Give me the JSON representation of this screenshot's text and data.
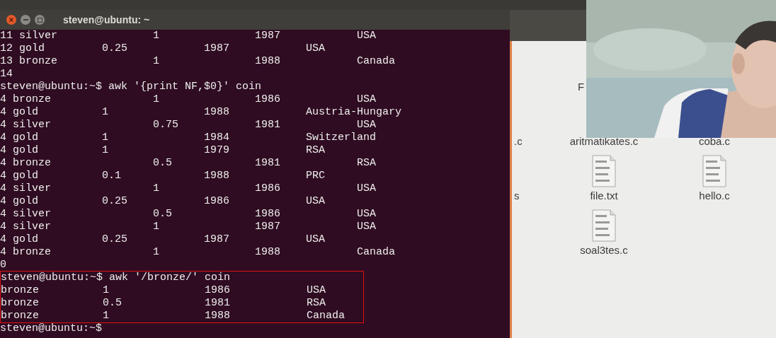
{
  "terminal": {
    "title": "steven@ubuntu: ~",
    "lines": [
      {
        "text": "11 silver\t\t1\t\t1987\t\tUSA",
        "highlighted": false
      },
      {
        "text": "12 gold\t\t0.25\t\t1987\t\tUSA",
        "highlighted": false
      },
      {
        "text": "13 bronze\t\t1\t\t1988\t\tCanada",
        "highlighted": false
      },
      {
        "text": "14",
        "highlighted": false
      },
      {
        "text": "steven@ubuntu:~$ awk '{print NF,$0}' coin",
        "highlighted": false
      },
      {
        "text": "4 bronze\t\t1\t\t1986\t\tUSA",
        "highlighted": false
      },
      {
        "text": "4 gold\t\t1\t\t1988\t\tAustria-Hungary",
        "highlighted": false
      },
      {
        "text": "4 silver\t\t0.75\t\t1981\t\tUSA",
        "highlighted": false
      },
      {
        "text": "4 gold\t\t1\t\t1984\t\tSwitzerland",
        "highlighted": false
      },
      {
        "text": "4 gold\t\t1\t\t1979\t\tRSA",
        "highlighted": false
      },
      {
        "text": "4 bronze\t\t0.5\t\t1981\t\tRSA",
        "highlighted": false
      },
      {
        "text": "4 gold\t\t0.1\t\t1988\t\tPRC",
        "highlighted": false
      },
      {
        "text": "4 silver\t\t1\t\t1986\t\tUSA",
        "highlighted": false
      },
      {
        "text": "4 gold\t\t0.25\t\t1986\t\tUSA",
        "highlighted": false
      },
      {
        "text": "4 silver\t\t0.5\t\t1986\t\tUSA",
        "highlighted": false
      },
      {
        "text": "4 silver\t\t1\t\t1987\t\tUSA",
        "highlighted": false
      },
      {
        "text": "4 gold\t\t0.25\t\t1987\t\tUSA",
        "highlighted": false
      },
      {
        "text": "4 bronze\t\t1\t\t1988\t\tCanada",
        "highlighted": false
      },
      {
        "text": "0",
        "highlighted": false
      },
      {
        "text": "steven@ubuntu:~$ awk '/bronze/' coin",
        "highlighted": true
      },
      {
        "text": "bronze\t\t1\t\t1986\t\tUSA",
        "highlighted": true
      },
      {
        "text": "bronze\t\t0.5\t\t1981\t\tRSA",
        "highlighted": true
      },
      {
        "text": "bronze\t\t1\t\t1988\t\tCanada",
        "highlighted": true
      },
      {
        "text": "steven@ubuntu:~$",
        "highlighted": false
      }
    ]
  },
  "file_manager": {
    "rows": [
      [
        {
          "kind": "empty"
        },
        {
          "kind": "name",
          "label": "F"
        },
        {
          "kind": "empty"
        }
      ],
      [
        {
          "kind": "name",
          "label": ".c"
        },
        {
          "kind": "name",
          "label": "aritmatikates.c"
        },
        {
          "kind": "name",
          "label": "coba.c"
        }
      ],
      [
        {
          "kind": "name",
          "label": "s"
        },
        {
          "kind": "file",
          "label": "file.txt"
        },
        {
          "kind": "file",
          "label": "hello.c"
        }
      ],
      [
        {
          "kind": "empty"
        },
        {
          "kind": "file",
          "label": "soal3tes.c"
        },
        {
          "kind": "empty"
        }
      ]
    ]
  }
}
